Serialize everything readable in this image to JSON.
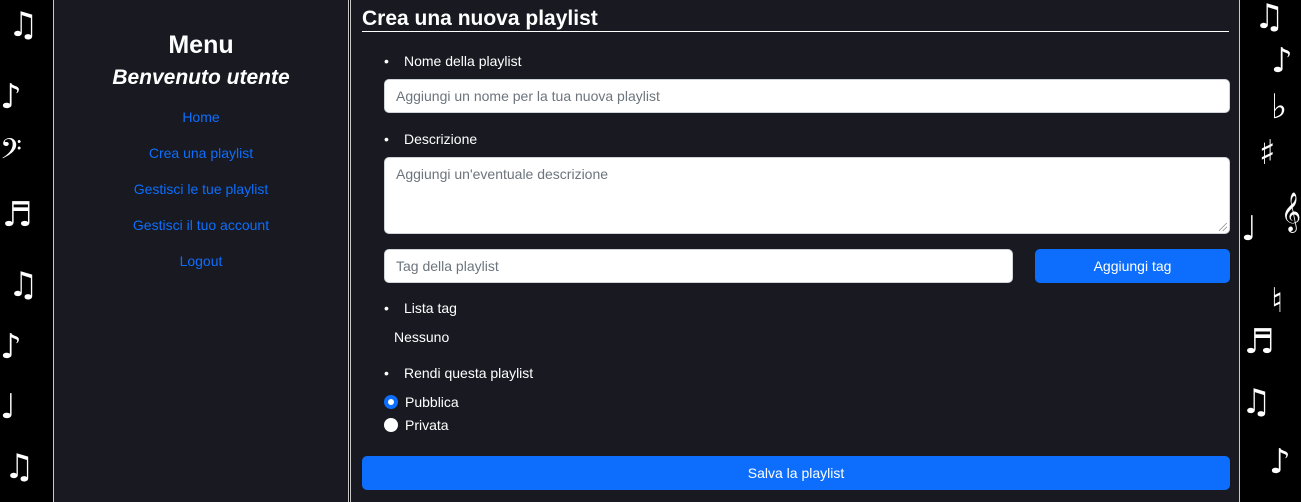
{
  "sidebar": {
    "heading": "Menu",
    "welcome": "Benvenuto utente",
    "links": [
      {
        "label": "Home"
      },
      {
        "label": "Crea una playlist"
      },
      {
        "label": "Gestisci le tue playlist"
      },
      {
        "label": "Gestisci il tuo account"
      },
      {
        "label": "Logout"
      }
    ]
  },
  "form": {
    "title": "Crea una nuova playlist",
    "name_label": "Nome della playlist",
    "name_placeholder": "Aggiungi un nome per la tua nuova playlist",
    "description_label": "Descrizione",
    "description_placeholder": "Aggiungi un'eventuale descrizione",
    "tag_placeholder": "Tag della playlist",
    "add_tag_button": "Aggiungi tag",
    "tag_list_label": "Lista tag",
    "tag_list_empty": "Nessuno",
    "visibility_label": "Rendi questa playlist",
    "visibility_options": [
      {
        "label": "Pubblica",
        "selected": true
      },
      {
        "label": "Privata",
        "selected": false
      }
    ],
    "save_button": "Salva la playlist"
  },
  "colors": {
    "accent": "#0d6efd",
    "panel": "#181921",
    "background": "#000000"
  }
}
